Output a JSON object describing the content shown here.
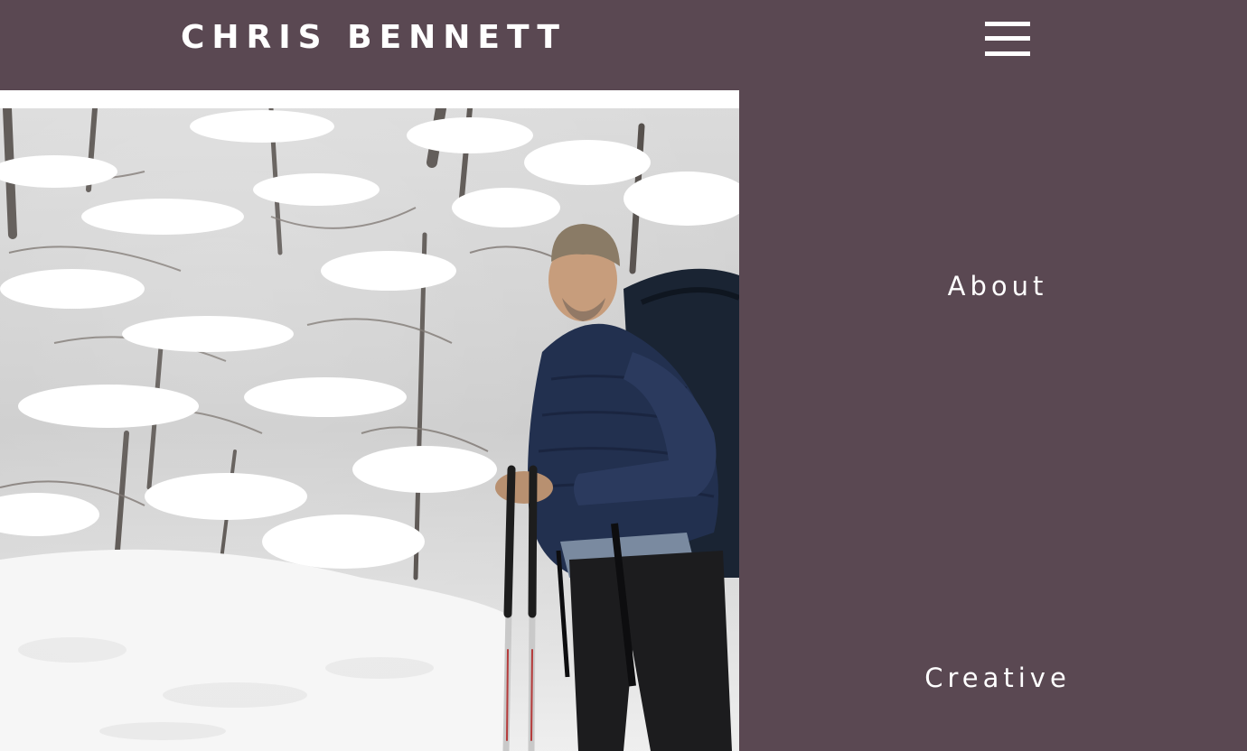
{
  "header": {
    "site_title": "CHRIS BENNETT",
    "menu_icon": "hamburger-menu-icon"
  },
  "colors": {
    "background": "#5a4852",
    "text": "#ffffff",
    "photo_frame": "#ffffff"
  },
  "hero": {
    "image_description": "Hiker with backpack and trekking poles in snowy forest"
  },
  "nav": {
    "items": [
      {
        "label": "About"
      },
      {
        "label": "Creative"
      }
    ]
  }
}
